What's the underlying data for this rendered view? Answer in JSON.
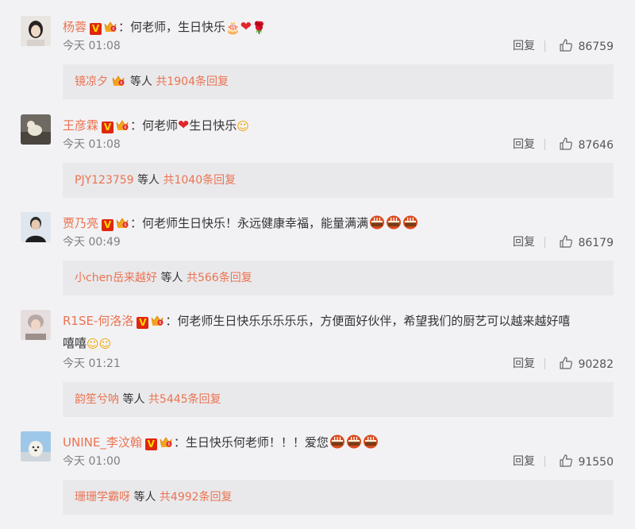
{
  "comments": [
    {
      "user": "杨蓉",
      "text": "：何老师，生日快乐",
      "time": "今天 01:08",
      "reply_label": "回复",
      "likes": "86759",
      "sub_user": "镜凉夕",
      "sub_mid": "等人",
      "sub_total": "共1904条回复",
      "avatar_icon": "avatar-woman-photo"
    },
    {
      "user": "王彦霖",
      "text_a": "：何老师",
      "text_b": "生日快乐",
      "time": "今天 01:08",
      "reply_label": "回复",
      "likes": "87646",
      "sub_user": "PJY123759",
      "sub_mid": "等人",
      "sub_total": "共1040条回复",
      "avatar_icon": "avatar-dog-photo"
    },
    {
      "user": "贾乃亮",
      "text": "：何老师生日快乐！永远健康幸福，能量满满",
      "time": "今天 00:49",
      "reply_label": "回复",
      "likes": "86179",
      "sub_user": "小chen岳来越好",
      "sub_mid": "等人",
      "sub_total": "共566条回复",
      "avatar_icon": "avatar-man-photo"
    },
    {
      "user": "R1SE-何洛洛",
      "text": "：何老师生日快乐乐乐乐乐，方便面好伙伴，希望我们的厨艺可以越来越好嘻",
      "text2": "嘻嘻",
      "time": "今天 01:21",
      "reply_label": "回复",
      "likes": "90282",
      "sub_user": "韵笙兮呐",
      "sub_mid": "等人",
      "sub_total": "共5445条回复",
      "avatar_icon": "avatar-person-photo"
    },
    {
      "user": "UNINE_李汶翰",
      "text": "：生日快乐何老师！！！爱您",
      "time": "今天 01:00",
      "reply_label": "回复",
      "likes": "91550",
      "sub_user": "珊珊学霸呀",
      "sub_mid": "等人",
      "sub_total": "共4992条回复",
      "avatar_icon": "avatar-dog-sky-photo"
    }
  ],
  "colors": {
    "username": "#eb7350",
    "background": "#f2f2f5",
    "reply_box": "#e9e9ec",
    "verified_badge": "#e0260d"
  },
  "icons": [
    "verified-v-icon",
    "member-crown-icon",
    "like-thumb-icon",
    "cake-emoji",
    "heart-emoji",
    "rose-emoji",
    "smile-emoji",
    "grin-emoji"
  ]
}
